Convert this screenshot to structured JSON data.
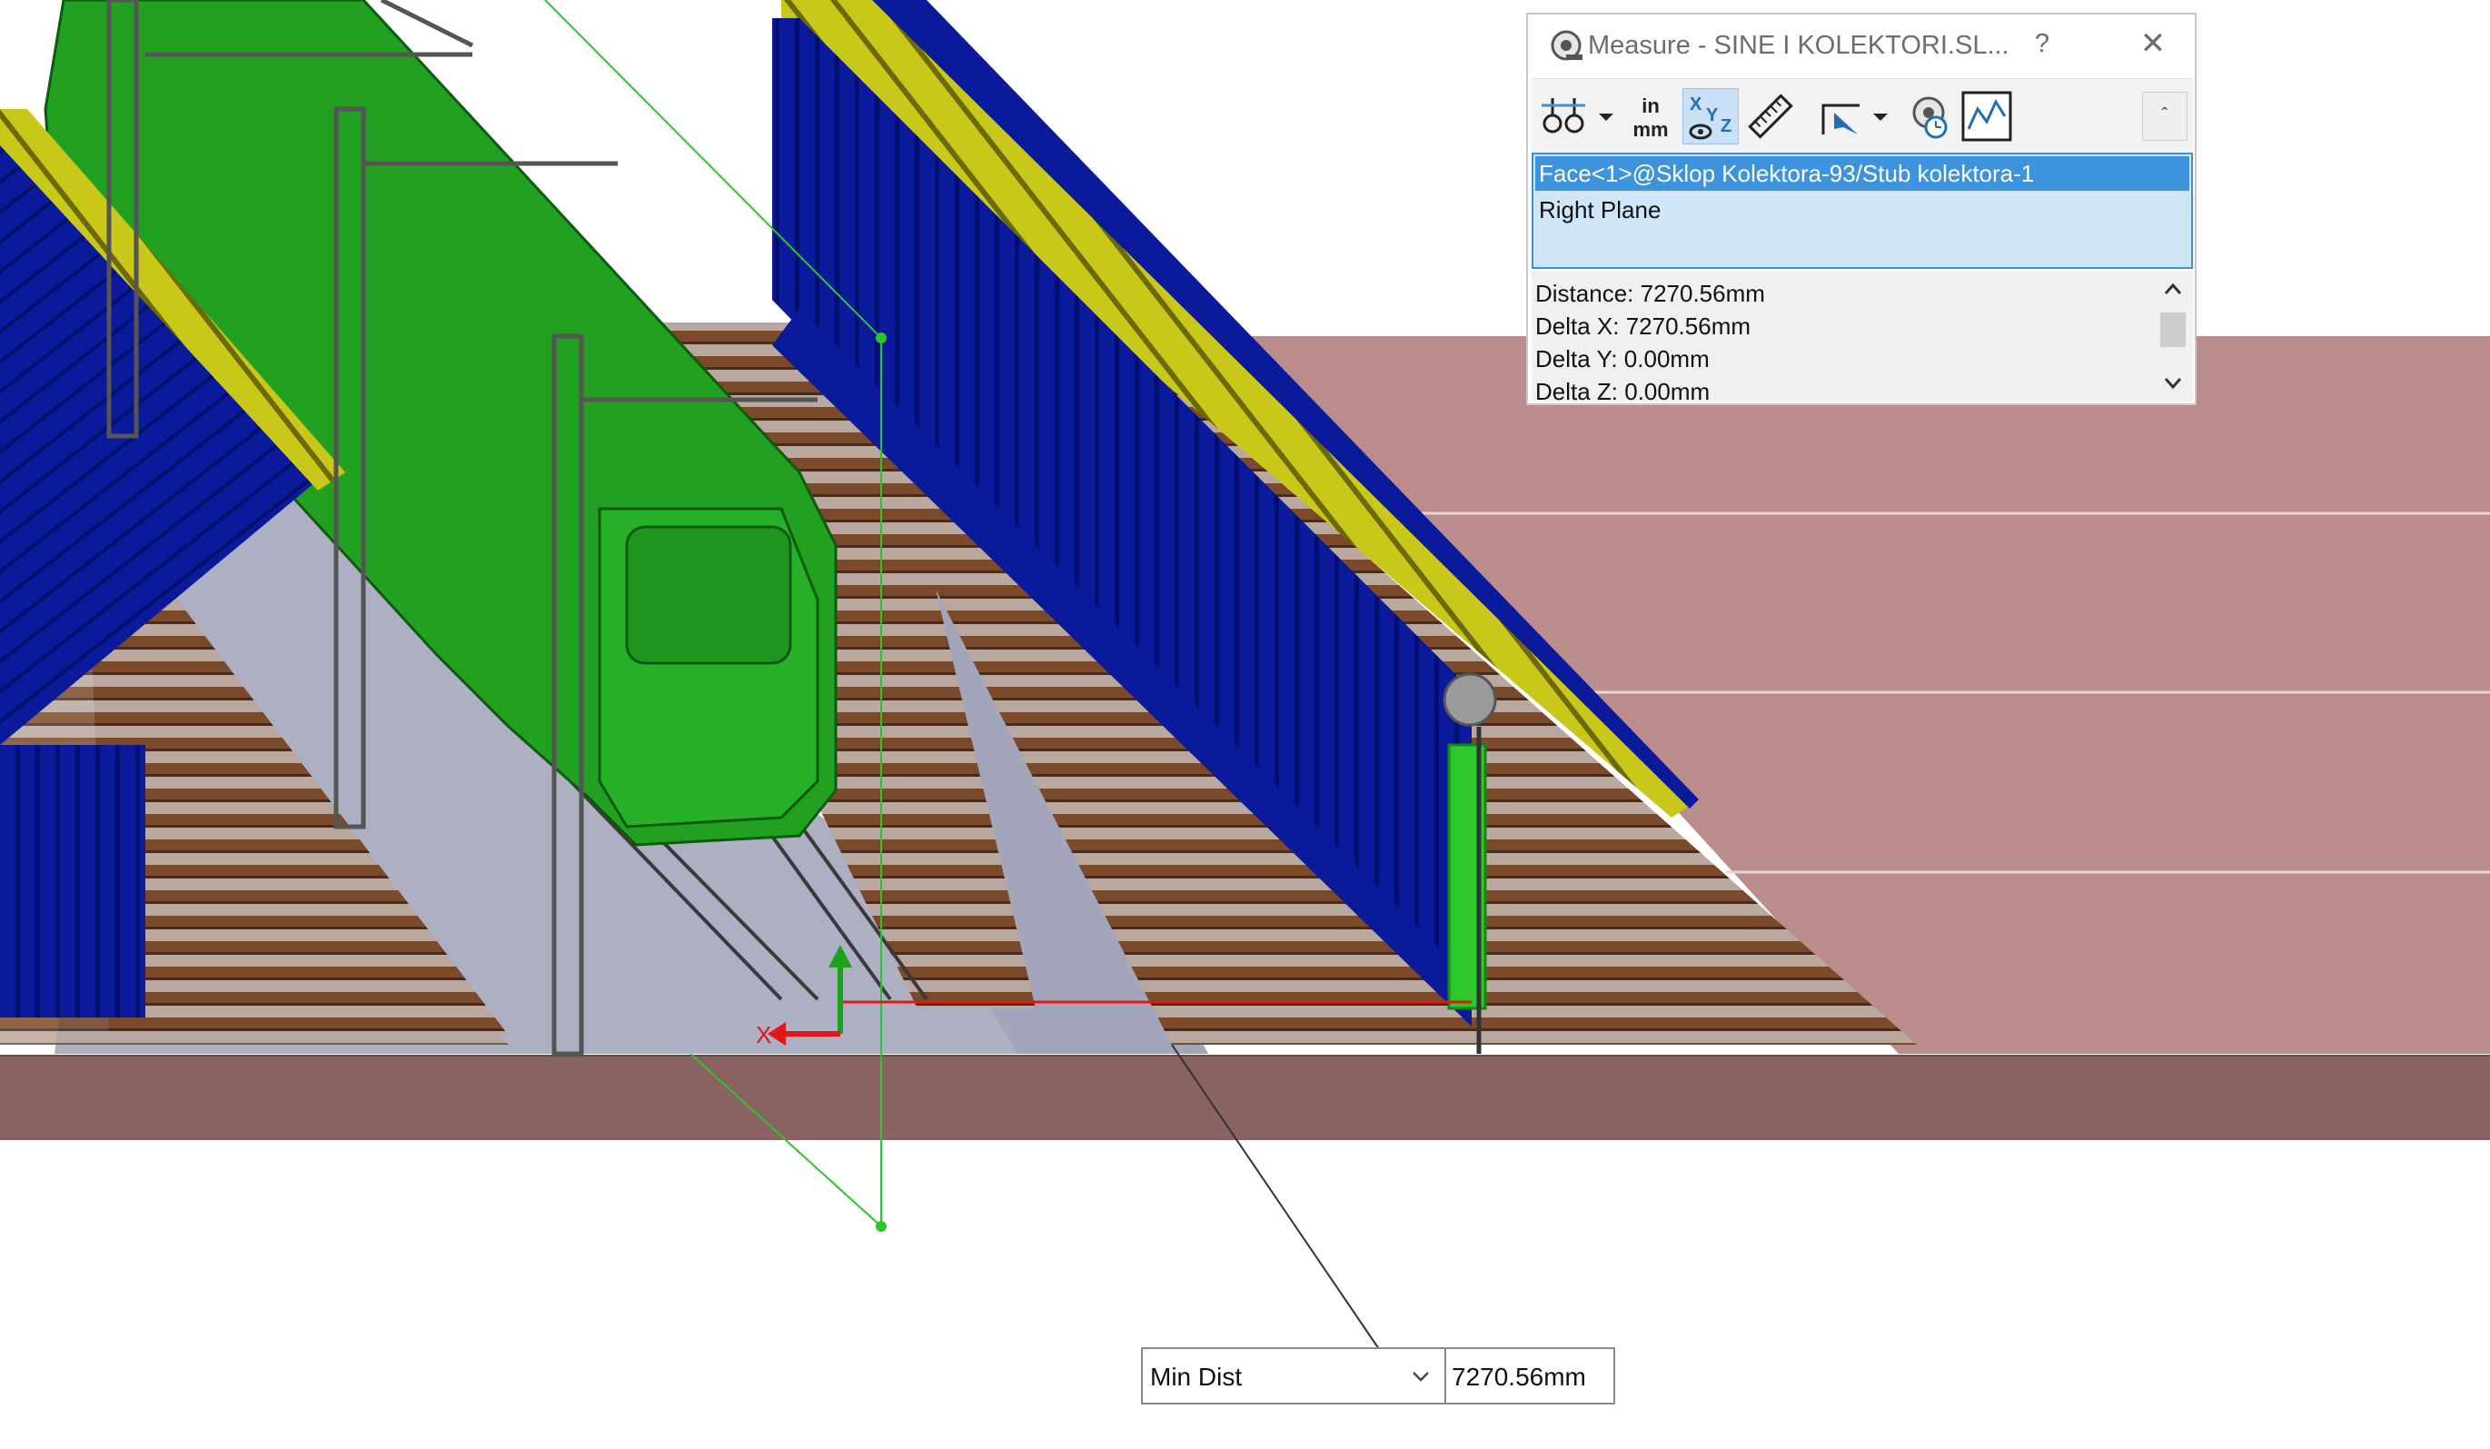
{
  "measure_dialog": {
    "title": "Measure - SINE I KOLEKTORI.SL...",
    "help_label": "?",
    "close_label": "✕",
    "collapse_label": "ˆ",
    "toolbar": {
      "icons": [
        "arc-circle-options-icon",
        "units-precision-icon",
        "show-xyz-icon",
        "point-to-point-icon",
        "projection-on-icon",
        "measure-history-icon",
        "create-sensor-icon"
      ],
      "units_label_top": "in",
      "units_label_bottom": "mm",
      "active_tool": "show-xyz-icon"
    },
    "selections": [
      {
        "label": "Face<1>@Sklop Kolektora-93/Stub kolektora-1",
        "selected": true
      },
      {
        "label": "Right Plane",
        "selected": false
      }
    ],
    "results": [
      "Distance: 7270.56mm",
      "Delta X: 7270.56mm",
      "Delta Y: 0.00mm",
      "Delta Z: 0.00mm"
    ]
  },
  "callout": {
    "mode": "Min Dist",
    "value": "7270.56mm"
  },
  "viewport": {
    "triad_x_label": "X",
    "colors": {
      "roof_panel": "#0a1a9a",
      "roof_edge": "#c9c81a",
      "train": "#22a022",
      "ground": "#a97f7f",
      "ground_side": "#8a6262",
      "rail_sleeper": "#7a4a2a",
      "platform": "#aeb0c2",
      "measure_line": "#e01818",
      "plane_line": "#28c828"
    }
  }
}
